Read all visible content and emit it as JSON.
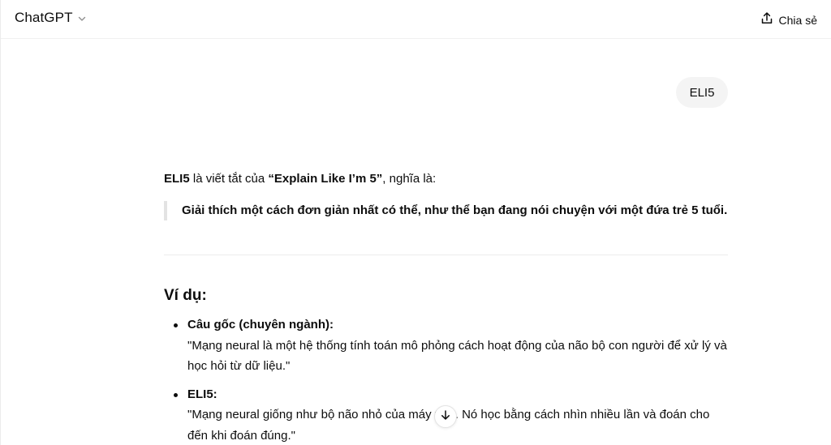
{
  "header": {
    "model_name": "ChatGPT",
    "share_label": "Chia sẻ"
  },
  "conversation": {
    "user_message": "ELI5",
    "assistant": {
      "intro": {
        "term": "ELI5",
        "middle": " là viết tắt của ",
        "expansion": "“Explain Like I’m 5”",
        "tail": ", nghĩa là:"
      },
      "blockquote": "Giải thích một cách đơn giản nhất có thể, như thể bạn đang nói chuyện với một đứa trẻ 5 tuổi.",
      "heading": "Ví dụ:",
      "examples": [
        {
          "title": "Câu gốc (chuyên ngành):",
          "text": "\"Mạng neural là một hệ thống tính toán mô phỏng cách hoạt động của não bộ con người để xử lý và học hỏi từ dữ liệu.\""
        },
        {
          "title": "ELI5:",
          "text": "\"Mạng neural giống như bộ não nhỏ của máy tính. Nó học bằng cách nhìn nhiều lần và đoán cho đến khi đoán đúng.\""
        }
      ]
    }
  },
  "icons": {
    "chevron": "chevron-down-icon",
    "share": "share-icon",
    "scroll": "arrow-down-icon"
  },
  "colors": {
    "user_bubble": "#f4f4f4",
    "blockquote_border": "#e3e3e3",
    "text": "#0d0d0d"
  }
}
